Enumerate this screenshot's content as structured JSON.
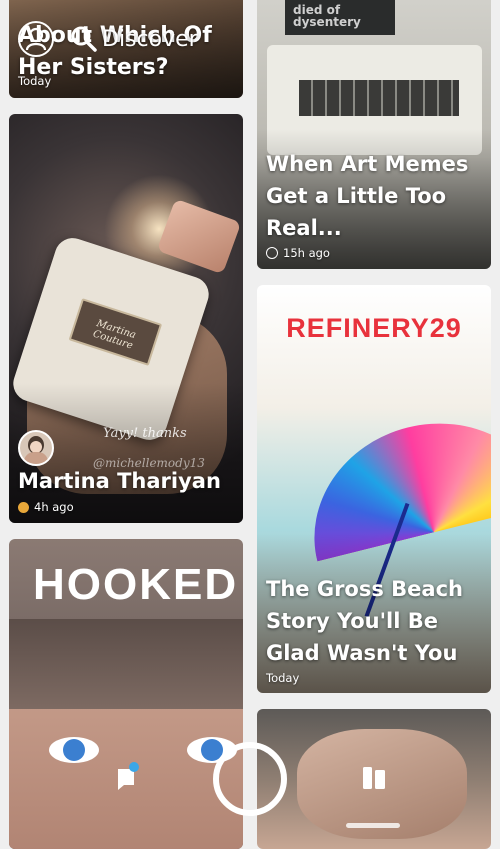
{
  "header": {
    "title": "Discover",
    "icons": {
      "profile": "profile-icon",
      "search": "search-icon"
    }
  },
  "cards": {
    "sisters": {
      "title": "About Which Of Her Sisters?",
      "meta": "Today"
    },
    "art_memes": {
      "title": "When Art Memes Get a Little Too Real...",
      "meta": "15h ago",
      "overlay_text": "died of dysentery",
      "icon": "globe-icon"
    },
    "martina": {
      "title": "Martina Thariyan",
      "meta": "4h ago",
      "caption": "Yayy! thanks",
      "handle": "@michellemody13",
      "product_text": "Martina Couture",
      "icon": "lion-emoji"
    },
    "beach": {
      "publisher": "REFINERY29",
      "title": "The Gross Beach Story You'll Be Glad Wasn't You",
      "meta": "Today"
    },
    "hooked": {
      "title": "HOOKED"
    }
  },
  "nav": {
    "icons": {
      "chat": "chat-icon",
      "capture": "capture-button",
      "stories": "stories-icon"
    }
  },
  "colors": {
    "refinery": "#e8323c",
    "notification": "#3aa6e6",
    "background": "#efefef"
  }
}
